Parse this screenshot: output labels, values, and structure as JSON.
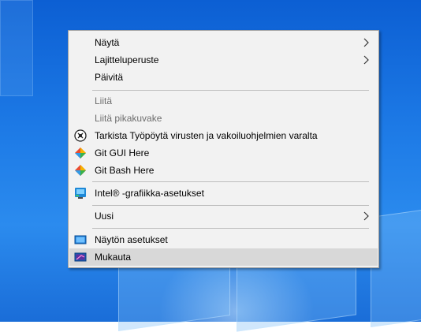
{
  "menu": {
    "items": [
      {
        "label": "Näytä",
        "submenu": true
      },
      {
        "label": "Lajitteluperuste",
        "submenu": true
      },
      {
        "label": "Päivitä"
      },
      {
        "label": "Liitä",
        "disabled": true
      },
      {
        "label": "Liitä pikakuvake",
        "disabled": true
      },
      {
        "label": "Tarkista Työpöytä virusten ja vakoiluohjelmien varalta",
        "icon": "defender-scan-icon"
      },
      {
        "label": "Git GUI Here",
        "icon": "git-icon"
      },
      {
        "label": "Git Bash Here",
        "icon": "git-icon"
      },
      {
        "label": "Intel® -grafiikka-asetukset",
        "icon": "intel-graphics-icon"
      },
      {
        "label": "Uusi",
        "submenu": true
      },
      {
        "label": "Näytön asetukset",
        "icon": "display-icon"
      },
      {
        "label": "Mukauta",
        "icon": "personalize-icon",
        "highlighted": true
      }
    ]
  },
  "colors": {
    "menu_bg": "#f2f2f2",
    "highlight": "#d8d8d8",
    "desktop": "#1d7ae6"
  }
}
